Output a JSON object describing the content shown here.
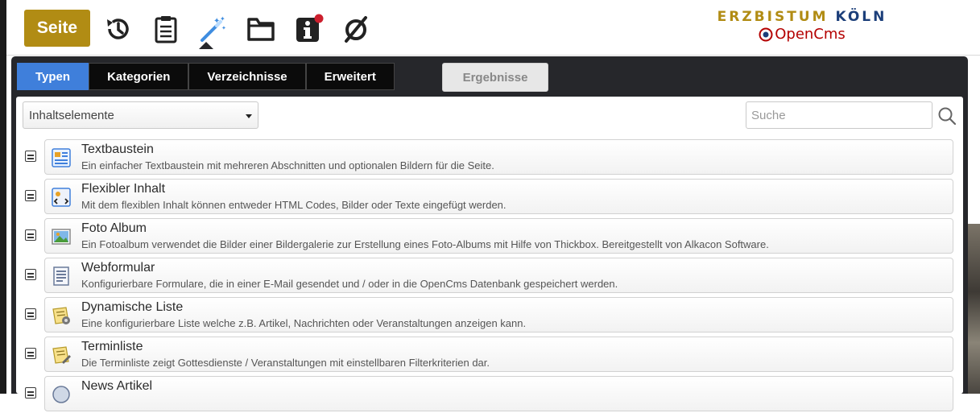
{
  "toolbar": {
    "page_button": "Seite",
    "icons": [
      "history-icon",
      "clipboard-icon",
      "magic-wand-icon",
      "folder-icon",
      "info-icon",
      "hidden-icon"
    ],
    "logo_line1_a": "ERZBISTUM ",
    "logo_line1_b": "KÖLN",
    "logo_line2": "OpenCms"
  },
  "tabs": {
    "types": "Typen",
    "categories": "Kategorien",
    "folders": "Verzeichnisse",
    "advanced": "Erweitert",
    "results": "Ergebnisse"
  },
  "filter": {
    "selected": "Inhaltselemente",
    "search_placeholder": "Suche"
  },
  "items": [
    {
      "title": "Textbaustein",
      "description": "Ein einfacher Textbaustein mit mehreren Abschnitten und optionalen Bildern für die Seite.",
      "icon": "text-block-icon"
    },
    {
      "title": "Flexibler Inhalt",
      "description": "Mit dem flexiblen Inhalt können entweder HTML Codes, Bilder oder Texte eingefügt werden.",
      "icon": "flexible-content-icon"
    },
    {
      "title": "Foto Album",
      "description": "Ein Fotoalbum verwendet die Bilder einer Bildergalerie zur Erstellung eines Foto-Albums mit Hilfe von Thickbox. Bereitgestellt von Alkacon Software.",
      "icon": "photo-album-icon"
    },
    {
      "title": "Webformular",
      "description": "Konfigurierbare Formulare, die in einer E-Mail gesendet und / oder in die OpenCms Datenbank gespeichert werden.",
      "icon": "web-form-icon"
    },
    {
      "title": "Dynamische Liste",
      "description": "Eine konfigurierbare Liste welche z.B. Artikel, Nachrichten oder Veranstaltungen anzeigen kann.",
      "icon": "dynamic-list-icon"
    },
    {
      "title": "Terminliste",
      "description": "Die Terminliste zeigt Gottesdienste / Veranstaltungen mit einstellbaren Filterkriterien dar.",
      "icon": "event-list-icon"
    },
    {
      "title": "News Artikel",
      "description": "",
      "icon": "news-article-icon"
    }
  ],
  "colors": {
    "accent_gold": "#b18c14",
    "tab_active": "#3f7fdb",
    "panel_bg": "#26272b"
  }
}
